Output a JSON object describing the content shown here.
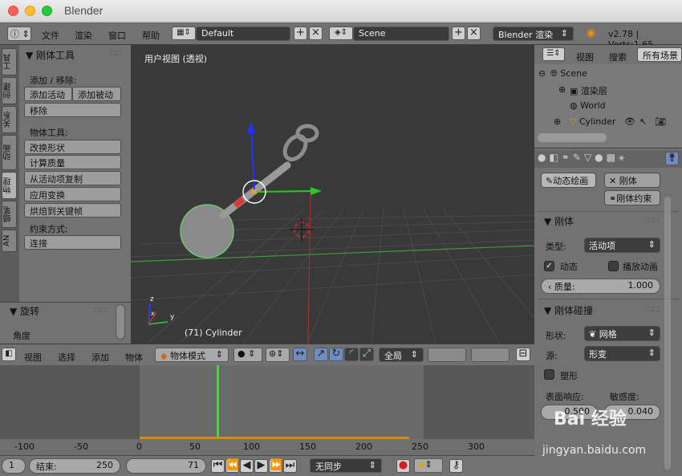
{
  "window": {
    "title": "Blender"
  },
  "topbar": {
    "menus": [
      "文件",
      "渲染",
      "窗口",
      "帮助"
    ],
    "layout": "Default",
    "scene": "Scene",
    "engine": "Blender 渲染",
    "version": "v2.78 | Verts:1,65"
  },
  "tool_tabs": [
    "工具",
    "创建",
    "关系",
    "动画",
    "物理",
    "蜡笔",
    "AN"
  ],
  "tool_panel": {
    "header": "刚体工具",
    "add_remove_label": "添加 / 移除:",
    "add_active": "添加活动",
    "add_passive": "添加被动",
    "remove": "移除",
    "object_tools_label": "物体工具:",
    "buttons": [
      "改换形状",
      "计算质量",
      "从活动项复制",
      "应用变换",
      "烘焙到关键帧"
    ],
    "constraint_label": "约束方式:",
    "connect": "连接"
  },
  "operator_panel": {
    "header": "旋转",
    "angle_label": "角度"
  },
  "viewport": {
    "label": "用户视图 (透视)",
    "object_label": "(71) Cylinder",
    "axis_labels": [
      "z",
      "y",
      "x"
    ]
  },
  "view3d_header": {
    "menus": [
      "视图",
      "选择",
      "添加",
      "物体"
    ],
    "mode": "物体模式",
    "orientation": "全局"
  },
  "timeline": {
    "ticks": [
      "-100",
      "-50",
      "0",
      "50",
      "100",
      "150",
      "200",
      "250",
      "300"
    ],
    "current_frame_marker": 70
  },
  "timeline_bar": {
    "start": "1",
    "end_label": "结束:",
    "end_value": "250",
    "current": "71",
    "sync": "无同步"
  },
  "outliner": {
    "menus": [
      "视图",
      "搜索"
    ],
    "filter": "所有场景",
    "items": [
      "Scene",
      "渲染层",
      "World",
      "Cylinder"
    ]
  },
  "properties": {
    "dynamic_paint": "动态绘画",
    "rigid_body": "刚体",
    "rigid_body_constraint": "刚体约束",
    "rb_header": "刚体",
    "type_label": "类型:",
    "type_value": "活动项",
    "dynamic": "动态",
    "animated": "播放动画",
    "mass_label": "质量:",
    "mass_value": "1.000",
    "collision_header": "刚体碰撞",
    "shape_label": "形状:",
    "shape_value": "网格",
    "source_label": "源:",
    "source_value": "形变",
    "deform": "塑形",
    "friction_label": "表面响应:",
    "sensitivity_label": "敏感度:",
    "friction_value": "0.500",
    "sensitivity_value": "0.040"
  },
  "watermark": {
    "text": "Bai 经验",
    "url": "jingyan.baidu.com"
  }
}
